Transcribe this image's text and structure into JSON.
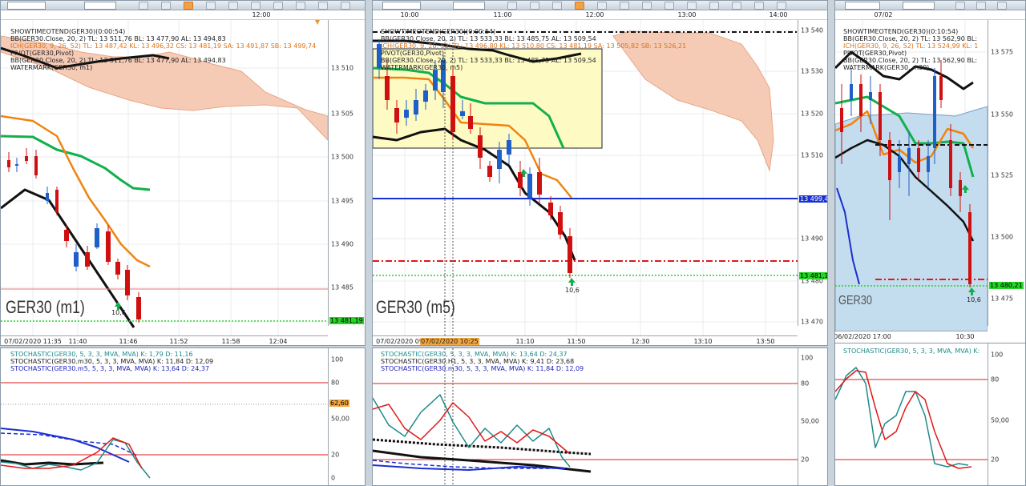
{
  "colors": {
    "bull": "#1f5fc8",
    "bear": "#d01010",
    "bb_green": "#12b04c",
    "ich_orange": "#ee8510",
    "cloud_bear": "#f6cbb6",
    "cloud_bull": "#c3dcee",
    "level_blue": "#1a2fd0",
    "level_red": "#e01818",
    "level_green": "#26d326"
  },
  "pane1": {
    "toolbar": {
      "symbol": "GER30",
      "timeframe": "M1"
    },
    "top_time": "12:00",
    "legend": [
      {
        "text": "SHOWTIMEOTEND(GER30)(0:00:54)",
        "color": "#222"
      },
      {
        "text": "BB(GER30.Close, 20, 2)  TL: 13 511,76  BL: 13 477,90  AL: 13 494,83",
        "color": "#222"
      },
      {
        "text": "ICH(GER30, 9, 26, 52)  TL: 13 487,42  KL: 13 496,32  CS: 13 481,19  SA: 13 491,87  SB: 13 499,74",
        "color": "#e07010"
      },
      {
        "text": "PIVOT(GER30,Pivot)",
        "color": "#222"
      },
      {
        "text": "BB(GER30.Close, 20, 2)  TL: 13 511,76  BL: 13 477,90  AL: 13 494,83",
        "color": "#222"
      },
      {
        "text": "WATERMARK(GER30, m1)",
        "color": "#222"
      }
    ],
    "y_ticks": [
      "13 510",
      "13 505",
      "13 500",
      "13 495",
      "13 490",
      "13 485"
    ],
    "price_tag": "13 481,19",
    "watermark": "GER30 (m1)",
    "signal_value": "10,6",
    "x_ticks": [
      "07/02/2020 11:35",
      "11:40",
      "11:46",
      "11:52",
      "11:58",
      "12:04"
    ],
    "stoch_legend": [
      {
        "text": "STOCHASTIC(GER30, 5, 3, 3, MVA, MVA)  K: 1,79  D: 11,16",
        "color": "#1e8a8a"
      },
      {
        "text": "STOCHASTIC(GER30.m30, 5, 3, 3, MVA, MVA)  K: 11,84  D: 12,09",
        "color": "#222"
      },
      {
        "text": "STOCHASTIC(GER30.m5, 5, 3, 3, MVA, MVA)  K: 13,64  D: 24,37",
        "color": "#2020c0"
      }
    ],
    "stoch_ticks": [
      "100",
      "80",
      "50,00",
      "20",
      "0"
    ],
    "stoch_tag": "62,60"
  },
  "pane2": {
    "toolbar": {
      "symbol": "GER30",
      "timeframe": "M5"
    },
    "top_times": [
      "10:00",
      "11:00",
      "12:00",
      "13:00",
      "14:00"
    ],
    "legend": [
      {
        "text": "SHOWTIMEOTEND(GER30)(0:00:54)",
        "color": "#222"
      },
      {
        "text": "BB(GER30.Close, 20, 2)  TL: 13 533,33  BL: 13 485,75  AL: 13 509,54",
        "color": "#222"
      },
      {
        "text": "ICH(GER30, 9, 26, 52)  TL: 13 496,80  KL: 13 510,80  CS: 13 481,19  SA: 13 505,82  SB: 13 526,21",
        "color": "#e07010"
      },
      {
        "text": "PIVOT(GER30,Pivot)",
        "color": "#222"
      },
      {
        "text": "BB(GER30.Close, 20, 2)  TL: 13 533,33  BL: 13 485,75  AL: 13 509,54",
        "color": "#222"
      },
      {
        "text": "WATERMARK(GER30, m5)",
        "color": "#222"
      }
    ],
    "y_ticks": [
      "13 540",
      "13 530",
      "13 520",
      "13 510",
      "13 490",
      "13 480",
      "13 470"
    ],
    "price_tags": [
      "13 499,49",
      "13 481,19"
    ],
    "watermark": "GER30 (m5)",
    "signal_value": "10,6",
    "x_ticks": [
      "07/02/2020 09:40",
      "07/02/2020 10:25",
      "11:10",
      "11:50",
      "12:30",
      "13:10",
      "13:50"
    ],
    "stoch_legend": [
      {
        "text": "STOCHASTIC(GER30, 5, 3, 3, MVA, MVA)  K: 13,64  D: 24,37",
        "color": "#1e8a8a"
      },
      {
        "text": "STOCHASTIC(GER30.H1, 5, 3, 3, MVA, MVA)  K: 9,41  D: 23,68",
        "color": "#222"
      },
      {
        "text": "STOCHASTIC(GER30.m30, 5, 3, 3, MVA, MVA)  K: 11,84  D: 12,09",
        "color": "#2020c0"
      }
    ],
    "stoch_ticks": [
      "100",
      "80",
      "50,00",
      "20"
    ]
  },
  "pane3": {
    "toolbar": {
      "symbol": "GER30",
      "timeframe": "M30"
    },
    "top_time": "07/02",
    "legend": [
      {
        "text": "SHOWTIMEOTEND(GER30)(0:10:54)",
        "color": "#222"
      },
      {
        "text": "BB(GER30.Close, 20, 2)  TL: 13 562,90  BL:",
        "color": "#222"
      },
      {
        "text": "ICH(GER30, 9, 26, 52)  TL: 13 524,99  KL: 1",
        "color": "#e07010"
      },
      {
        "text": "PIVOT(GER30,Pivot)",
        "color": "#222"
      },
      {
        "text": "BB(GER30.Close, 20, 2)  TL: 13 562,90  BL:",
        "color": "#222"
      },
      {
        "text": "WATERMARK(GER30, m30)",
        "color": "#222"
      }
    ],
    "y_ticks": [
      "13 575",
      "13 550",
      "13 525",
      "13 500",
      "13 475"
    ],
    "price_tag": "13 480,21",
    "watermark": "GER30",
    "signal_value": "10,6",
    "x_ticks": [
      "06/02/2020 17:00",
      "10:30"
    ],
    "stoch_legend": [
      {
        "text": "STOCHASTIC(GER30, 5, 3, 3, MVA, MVA)  K:",
        "color": "#1e8a8a"
      }
    ],
    "stoch_ticks": [
      "100",
      "80",
      "50,00",
      "20"
    ]
  }
}
